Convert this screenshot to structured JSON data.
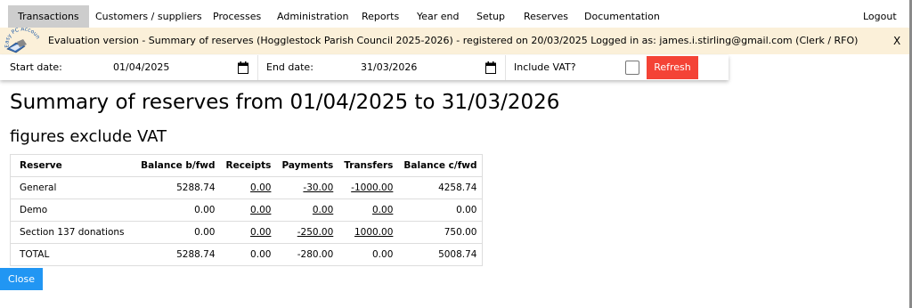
{
  "nav": {
    "items": [
      "Transactions",
      "Customers / suppliers",
      "Processes",
      "Administration",
      "Reports",
      "Year end",
      "Setup",
      "Reserves",
      "Documentation"
    ],
    "logout": "Logout"
  },
  "banner": {
    "logo_text": "Easy PC Accounts",
    "text": "Evaluation version - Summary of reserves (Hogglestock Parish Council 2025-2026) - registered on 20/03/2025 Logged in as: james.i.stirling@gmail.com (Clerk / RFO)",
    "close": "X"
  },
  "filters": {
    "start_label": "Start date:",
    "start_value": "01/04/2025",
    "end_label": "End date:",
    "end_value": "31/03/2026",
    "vat_label": "Include VAT?",
    "vat_checked": false,
    "refresh_label": "Refresh"
  },
  "report": {
    "title": "Summary of reserves from 01/04/2025 to 31/03/2026",
    "subtitle": "figures exclude VAT",
    "columns": [
      "Reserve",
      "Balance b/fwd",
      "Receipts",
      "Payments",
      "Transfers",
      "Balance c/fwd"
    ],
    "rows": [
      {
        "reserve": "General",
        "bfwd": "5288.74",
        "receipts": "0.00",
        "payments": "-30.00",
        "transfers": "-1000.00",
        "cfwd": "4258.74"
      },
      {
        "reserve": "Demo",
        "bfwd": "0.00",
        "receipts": "0.00",
        "payments": "0.00",
        "transfers": "0.00",
        "cfwd": "0.00"
      },
      {
        "reserve": "Section 137 donations",
        "bfwd": "0.00",
        "receipts": "0.00",
        "payments": "-250.00",
        "transfers": "1000.00",
        "cfwd": "750.00"
      }
    ],
    "total": {
      "reserve": "TOTAL",
      "bfwd": "5288.74",
      "receipts": "0.00",
      "payments": "-280.00",
      "transfers": "0.00",
      "cfwd": "5008.74"
    }
  },
  "close_label": "Close",
  "colors": {
    "active_tab": "#cdcdcd",
    "banner_bg": "#fbf0d9",
    "refresh_bg": "#f44336",
    "close_bg": "#2196f3"
  }
}
